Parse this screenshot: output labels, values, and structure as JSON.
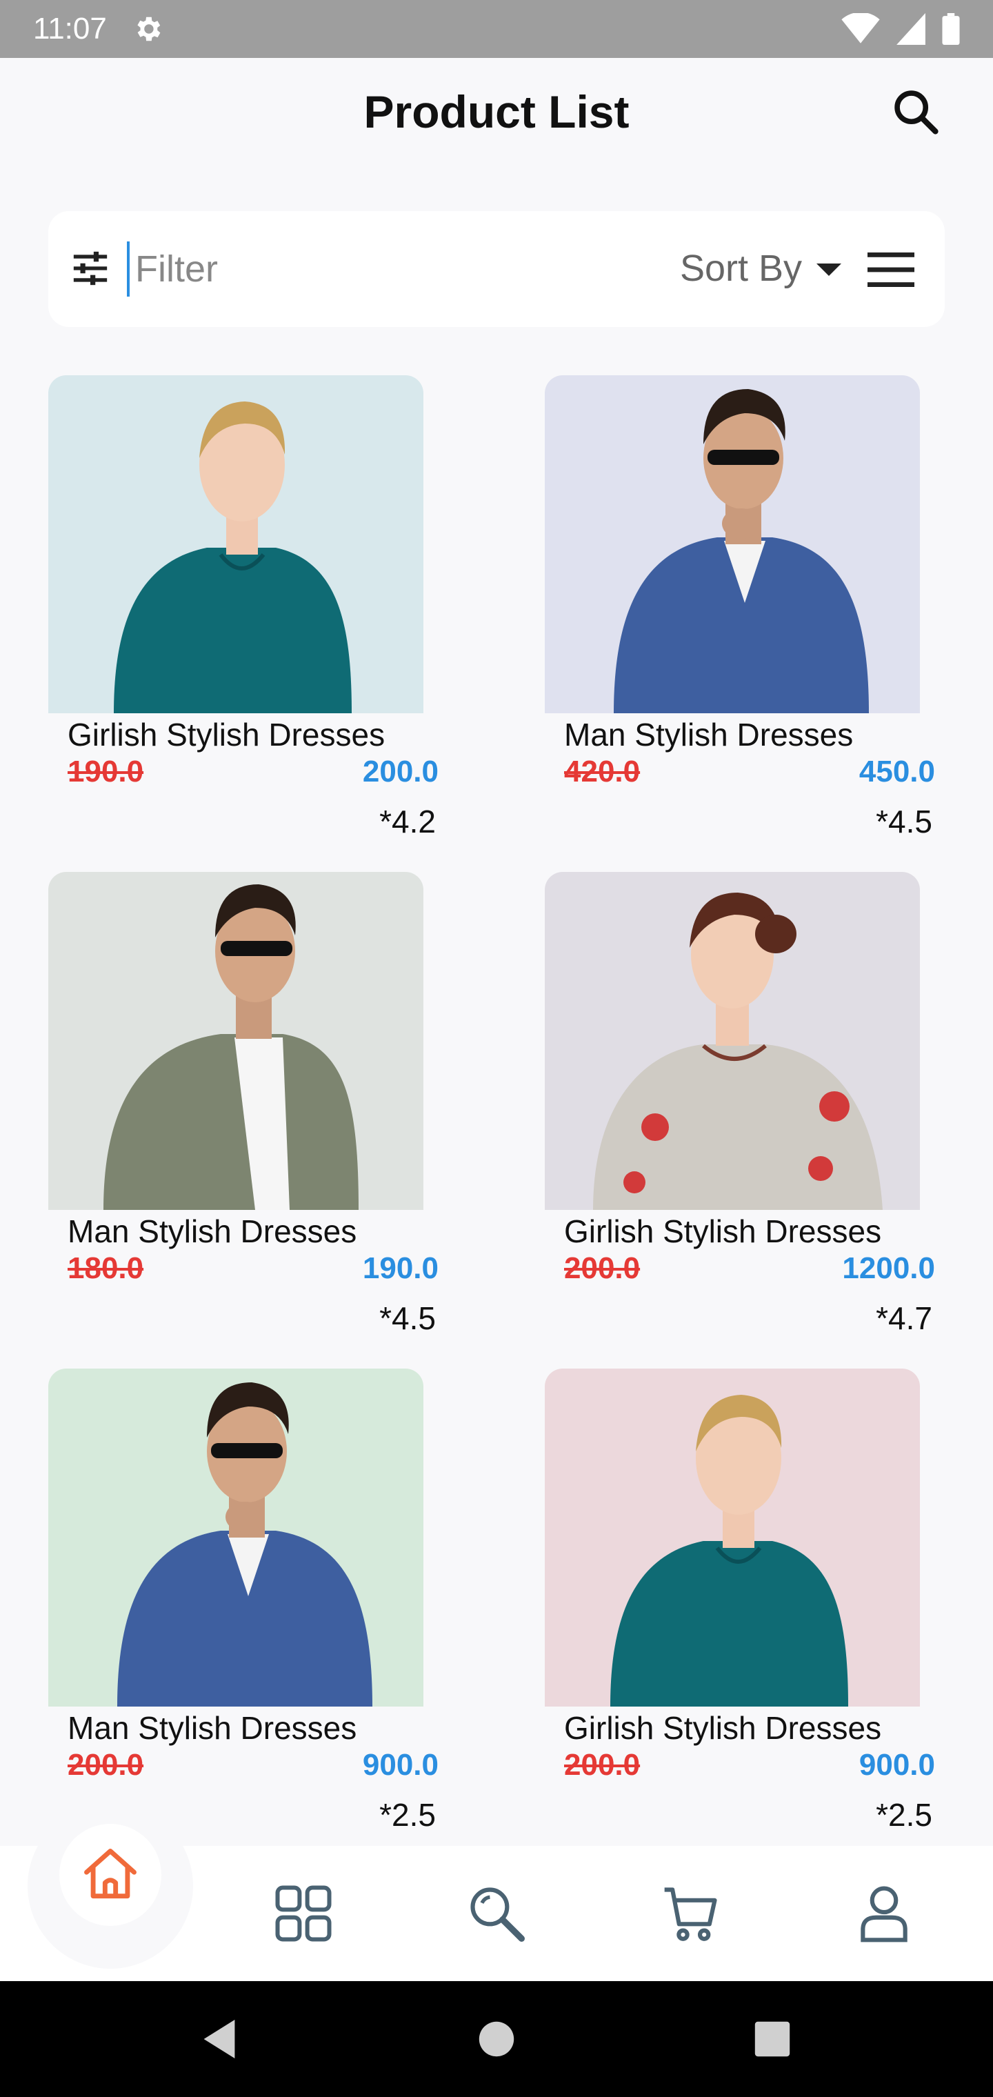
{
  "status_bar": {
    "time": "11:07"
  },
  "header": {
    "title": "Product List"
  },
  "filter_bar": {
    "placeholder": "Filter",
    "sort_label": "Sort By"
  },
  "products": [
    {
      "name": "Girlish Stylish Dresses",
      "old_price": "190.0",
      "new_price": "200.0",
      "rating": "*4.2",
      "bg": "#d8e8ec"
    },
    {
      "name": "Man Stylish Dresses",
      "old_price": "420.0",
      "new_price": "450.0",
      "rating": "*4.5",
      "bg": "#dfe1ef"
    },
    {
      "name": "Man Stylish Dresses",
      "old_price": "180.0",
      "new_price": "190.0",
      "rating": "*4.5",
      "bg": "#dfe3e0"
    },
    {
      "name": "Girlish Stylish Dresses",
      "old_price": "200.0",
      "new_price": "1200.0",
      "rating": "*4.7",
      "bg": "#e0dde4"
    },
    {
      "name": "Man Stylish Dresses",
      "old_price": "200.0",
      "new_price": "900.0",
      "rating": "*2.5",
      "bg": "#d6eadb"
    },
    {
      "name": "Girlish Stylish Dresses",
      "old_price": "200.0",
      "new_price": "900.0",
      "rating": "*2.5",
      "bg": "#ecd8dc"
    }
  ],
  "colors": {
    "old_price": "#e53935",
    "new_price": "#2a8ee0",
    "home_icon": "#f06a3a",
    "nav_icon": "#4a6272"
  },
  "icons": {
    "status": [
      "gear-icon",
      "wifi-icon",
      "signal-icon",
      "battery-icon"
    ],
    "header": "search-icon",
    "filter": [
      "sliders-icon",
      "caret-down-icon",
      "menu-icon"
    ],
    "nav": [
      "home-icon",
      "grid-icon",
      "search-icon",
      "cart-icon",
      "profile-icon"
    ],
    "system": [
      "back-icon",
      "home-circle-icon",
      "recents-icon"
    ]
  }
}
